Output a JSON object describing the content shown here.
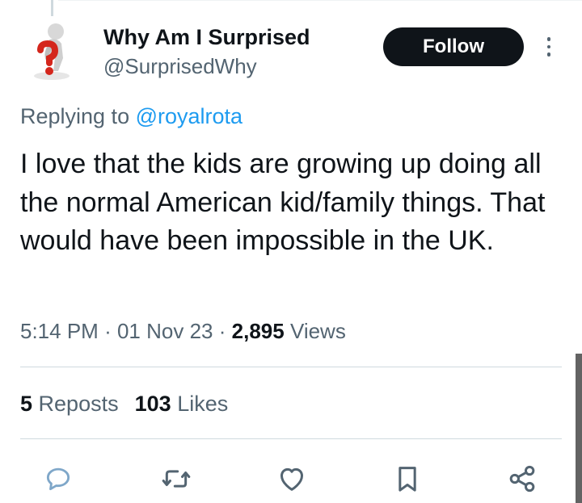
{
  "tweet": {
    "author": {
      "display_name": "Why Am I Surprised",
      "handle": "@SurprisedWhy",
      "avatar_icon": "question-mark-figure-avatar"
    },
    "follow_label": "Follow",
    "replying_prefix": "Replying to ",
    "replying_to": "@royalrota",
    "text": "I love that the kids are growing up doing all the normal American kid/family things. That would have been impossible in the UK.",
    "time": "5:14 PM",
    "date": "01 Nov 23",
    "separator": "·",
    "views_count": "2,895",
    "views_label": "Views",
    "reposts_count": "5",
    "reposts_label": "Reposts",
    "likes_count": "103",
    "likes_label": "Likes"
  },
  "actions": [
    {
      "name": "reply",
      "icon": "reply-bubble-icon"
    },
    {
      "name": "repost",
      "icon": "repost-arrows-icon"
    },
    {
      "name": "like",
      "icon": "heart-icon"
    },
    {
      "name": "bookmark",
      "icon": "bookmark-icon"
    },
    {
      "name": "share",
      "icon": "share-icon"
    }
  ],
  "colors": {
    "text_primary": "#0f1419",
    "text_secondary": "#536471",
    "link": "#1d9bf0",
    "button_bg": "#0f1419",
    "divider": "#cfd9de"
  }
}
